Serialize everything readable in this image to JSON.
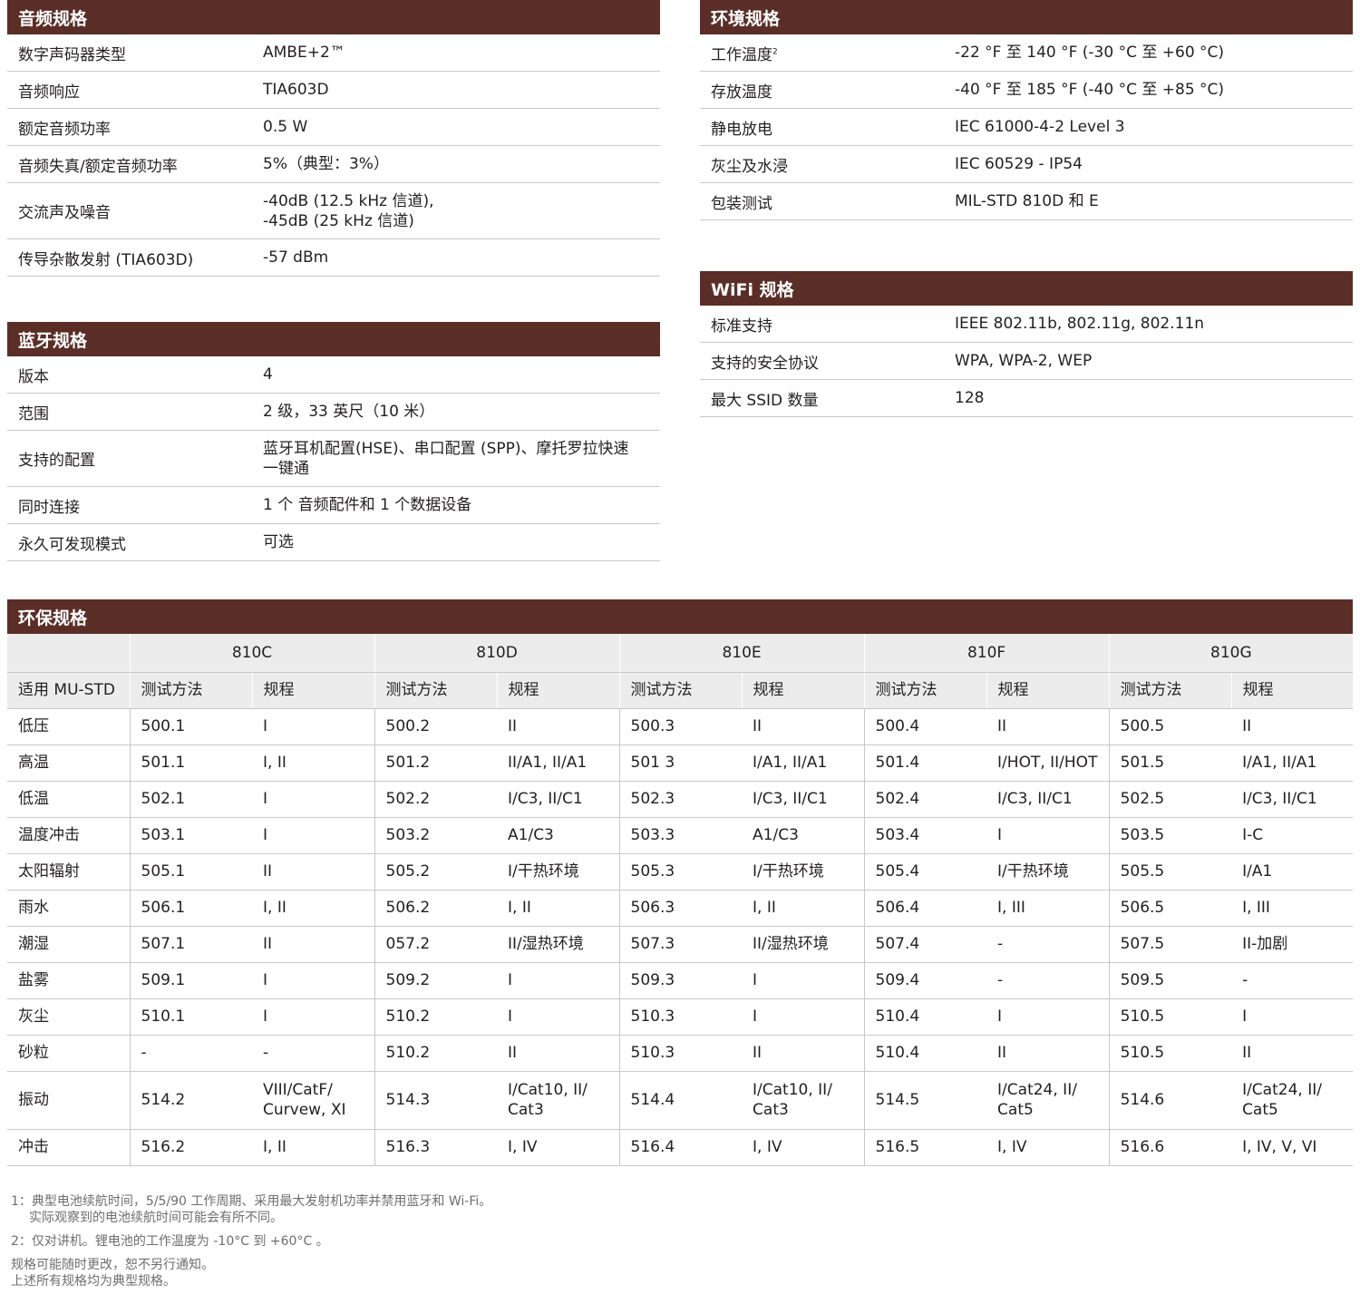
{
  "audio": {
    "title": "音频规格",
    "rows": [
      {
        "k": "数字声码器类型",
        "v": [
          "AMBE+2™"
        ]
      },
      {
        "k": "音频响应",
        "v": [
          "TIA603D"
        ]
      },
      {
        "k": "额定音频功率",
        "v": [
          "0.5 W"
        ]
      },
      {
        "k": "音频失真/额定音频功率",
        "v": [
          "5%（典型：3%）"
        ]
      },
      {
        "k": "交流声及噪音",
        "v": [
          "-40dB (12.5 kHz 信道),",
          "-45dB (25 kHz 信道)"
        ]
      },
      {
        "k": "传导杂散发射 (TIA603D)",
        "v": [
          "-57 dBm"
        ]
      }
    ]
  },
  "environment": {
    "title": "环境规格",
    "rows": [
      {
        "k": "工作温度",
        "sup": "2",
        "v": [
          "-22 °F 至 140 °F (-30 °C 至 +60 °C)"
        ]
      },
      {
        "k": "存放温度",
        "v": [
          "-40 °F 至 185 °F (-40 °C 至 +85 °C)"
        ]
      },
      {
        "k": "静电放电",
        "v": [
          "IEC 61000-4-2  Level 3"
        ]
      },
      {
        "k": "灰尘及水浸",
        "v": [
          "IEC 60529 -  IP54"
        ]
      },
      {
        "k": "包装测试",
        "v": [
          "MIL-STD 810D 和 E"
        ]
      }
    ]
  },
  "wifi": {
    "title": "WiFi 规格",
    "rows": [
      {
        "k": "标准支持",
        "v": [
          "IEEE 802.11b, 802.11g, 802.11n"
        ]
      },
      {
        "k": "支持的安全协议",
        "v": [
          "WPA, WPA-2, WEP"
        ]
      },
      {
        "k": "最大 SSID 数量",
        "v": [
          "128"
        ]
      }
    ]
  },
  "bluetooth": {
    "title": "蓝牙规格",
    "rows": [
      {
        "k": "版本",
        "v": [
          "4"
        ]
      },
      {
        "k": "范围",
        "v": [
          "2 级，33 英尺（10 米）"
        ]
      },
      {
        "k": "支持的配置",
        "v": [
          "蓝牙耳机配置(HSE)、串口配置 (SPP)、摩托罗拉快速",
          "一键通"
        ]
      },
      {
        "k": "同时连接",
        "v": [
          "1 个 音频配件和 1 个数据设备"
        ]
      },
      {
        "k": "永久可发现模式",
        "v": [
          "可选"
        ]
      }
    ]
  },
  "mil": {
    "title": "环保规格",
    "standards": [
      "810C",
      "810D",
      "810E",
      "810F",
      "810G"
    ],
    "sub_first": "适用 MU-STD",
    "sub_method": "测试方法",
    "sub_proc": "规程",
    "rows": [
      {
        "name": "低压",
        "cells": [
          [
            "500.1"
          ],
          [
            "I"
          ],
          [
            "500.2"
          ],
          [
            "II"
          ],
          [
            "500.3"
          ],
          [
            "II"
          ],
          [
            "500.4"
          ],
          [
            "II"
          ],
          [
            "500.5"
          ],
          [
            "II"
          ]
        ]
      },
      {
        "name": "高温",
        "cells": [
          [
            "501.1"
          ],
          [
            "I, II"
          ],
          [
            "501.2"
          ],
          [
            "II/A1, II/A1"
          ],
          [
            "501 3"
          ],
          [
            "I/A1, II/A1"
          ],
          [
            "501.4"
          ],
          [
            "I/HOT, II/HOT"
          ],
          [
            "501.5"
          ],
          [
            "I/A1, II/A1"
          ]
        ]
      },
      {
        "name": "低温",
        "cells": [
          [
            "502.1"
          ],
          [
            "I"
          ],
          [
            "502.2"
          ],
          [
            "I/C3, II/C1"
          ],
          [
            "502.3"
          ],
          [
            "I/C3, II/C1"
          ],
          [
            "502.4"
          ],
          [
            "I/C3, II/C1"
          ],
          [
            "502.5"
          ],
          [
            "I/C3, II/C1"
          ]
        ]
      },
      {
        "name": "温度冲击",
        "cells": [
          [
            "503.1"
          ],
          [
            "I"
          ],
          [
            "503.2"
          ],
          [
            "A1/C3"
          ],
          [
            "503.3"
          ],
          [
            "A1/C3"
          ],
          [
            "503.4"
          ],
          [
            "I"
          ],
          [
            "503.5"
          ],
          [
            "I-C"
          ]
        ]
      },
      {
        "name": "太阳辐射",
        "cells": [
          [
            "505.1"
          ],
          [
            "II"
          ],
          [
            "505.2"
          ],
          [
            "I/干热环境"
          ],
          [
            "505.3"
          ],
          [
            "I/干热环境"
          ],
          [
            "505.4"
          ],
          [
            "I/干热环境"
          ],
          [
            "505.5"
          ],
          [
            "I/A1"
          ]
        ]
      },
      {
        "name": "雨水",
        "cells": [
          [
            "506.1"
          ],
          [
            "I, II"
          ],
          [
            "506.2"
          ],
          [
            "I, II"
          ],
          [
            "506.3"
          ],
          [
            "I, II"
          ],
          [
            "506.4"
          ],
          [
            "I, III"
          ],
          [
            "506.5"
          ],
          [
            "I, III"
          ]
        ]
      },
      {
        "name": "潮湿",
        "cells": [
          [
            "507.1"
          ],
          [
            "II"
          ],
          [
            "057.2"
          ],
          [
            "II/湿热环境"
          ],
          [
            "507.3"
          ],
          [
            "II/湿热环境"
          ],
          [
            "507.4"
          ],
          [
            "-"
          ],
          [
            "507.5"
          ],
          [
            "II-加剧"
          ]
        ]
      },
      {
        "name": "盐雾",
        "cells": [
          [
            "509.1"
          ],
          [
            "I"
          ],
          [
            "509.2"
          ],
          [
            "I"
          ],
          [
            "509.3"
          ],
          [
            "I"
          ],
          [
            "509.4"
          ],
          [
            "-"
          ],
          [
            "509.5"
          ],
          [
            "-"
          ]
        ]
      },
      {
        "name": "灰尘",
        "cells": [
          [
            "510.1"
          ],
          [
            "I"
          ],
          [
            "510.2"
          ],
          [
            "I"
          ],
          [
            "510.3"
          ],
          [
            "I"
          ],
          [
            "510.4"
          ],
          [
            "I"
          ],
          [
            "510.5"
          ],
          [
            "I"
          ]
        ]
      },
      {
        "name": "砂粒",
        "cells": [
          [
            "-"
          ],
          [
            "-"
          ],
          [
            "510.2"
          ],
          [
            "II"
          ],
          [
            "510.3"
          ],
          [
            "II"
          ],
          [
            "510.4"
          ],
          [
            "II"
          ],
          [
            "510.5"
          ],
          [
            "II"
          ]
        ]
      },
      {
        "name": "振动",
        "cells": [
          [
            "514.2"
          ],
          [
            "VIII/CatF/",
            "Curvew, XI"
          ],
          [
            "514.3"
          ],
          [
            "I/Cat10, II/",
            "Cat3"
          ],
          [
            "514.4"
          ],
          [
            "I/Cat10, II/",
            "Cat3"
          ],
          [
            "514.5"
          ],
          [
            "I/Cat24, II/",
            "Cat5"
          ],
          [
            "514.6"
          ],
          [
            "I/Cat24, II/",
            "Cat5"
          ]
        ]
      },
      {
        "name": "冲击",
        "cells": [
          [
            "516.2"
          ],
          [
            "I, II"
          ],
          [
            "516.3"
          ],
          [
            "I, IV"
          ],
          [
            "516.4"
          ],
          [
            "I, IV"
          ],
          [
            "516.5"
          ],
          [
            "I, IV"
          ],
          [
            "516.6"
          ],
          [
            "I, IV, V, VI"
          ]
        ]
      }
    ]
  },
  "notes": {
    "n1a": "1：典型电池续航时间，5/5/90 工作周期、采用最大发射机功率并禁用蓝牙和 Wi-Fi。",
    "n1b": "实际观察到的电池续航时间可能会有所不同。",
    "n2": "2：仅对讲机。锂电池的工作温度为 -10°C 到 +60°C 。",
    "n3a": "规格可能随时更改，恕不另行通知。",
    "n3b": "上述所有规格均为典型规格。"
  }
}
